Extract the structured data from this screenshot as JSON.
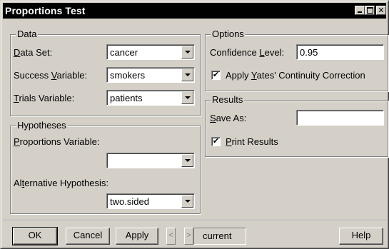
{
  "window": {
    "title": "Proportions Test"
  },
  "data_group": {
    "legend": "Data",
    "dataset_label_u": "D",
    "dataset_label_rest": "ata Set:",
    "dataset_value": "cancer",
    "success_label_pre": "Success ",
    "success_label_u": "V",
    "success_label_rest": "ariable:",
    "success_value": "smokers",
    "trials_label_u": "T",
    "trials_label_rest": "rials Variable:",
    "trials_value": "patients"
  },
  "hypotheses_group": {
    "legend": "Hypotheses",
    "prop_label_u": "P",
    "prop_label_rest": "roportions Variable:",
    "prop_value": "",
    "alt_label_pre": "Al",
    "alt_label_u": "t",
    "alt_label_rest": "ernative Hypothesis:",
    "alt_value": "two.sided"
  },
  "options_group": {
    "legend": "Options",
    "conf_label_pre": "Confidence ",
    "conf_label_u": "L",
    "conf_label_rest": "evel:",
    "conf_value": "0.95",
    "yates_checked": true,
    "yates_label_pre": "Apply ",
    "yates_label_u": "Y",
    "yates_label_rest": "ates' Continuity Correction"
  },
  "results_group": {
    "legend": "Results",
    "saveas_label_u": "S",
    "saveas_label_rest": "ave As:",
    "saveas_value": "",
    "print_checked": true,
    "print_label_u": "P",
    "print_label_rest": "rint Results"
  },
  "buttons": {
    "ok": "OK",
    "cancel": "Cancel",
    "apply": "Apply",
    "prev": "<",
    "next": ">",
    "current": "current",
    "help": "Help"
  },
  "icons": {
    "check": "✔"
  }
}
